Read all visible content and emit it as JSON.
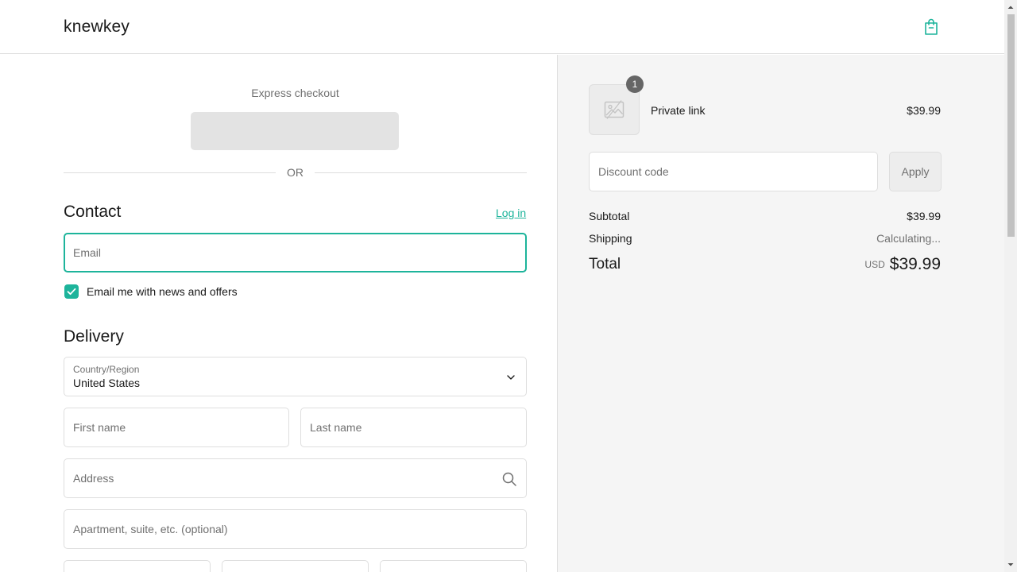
{
  "header": {
    "brand": "knewkey",
    "cart_icon": "shopping-bag-icon"
  },
  "express": {
    "label": "Express checkout",
    "divider": "OR"
  },
  "contact": {
    "title": "Contact",
    "login_label": "Log in",
    "email_placeholder": "Email",
    "newsletter_label": "Email me with news and offers",
    "newsletter_checked": true
  },
  "delivery": {
    "title": "Delivery",
    "country_label": "Country/Region",
    "country_value": "United States",
    "first_name_placeholder": "First name",
    "last_name_placeholder": "Last name",
    "address_placeholder": "Address",
    "apartment_placeholder": "Apartment, suite, etc. (optional)"
  },
  "summary": {
    "item": {
      "name": "Private link",
      "price": "$39.99",
      "quantity": "1",
      "image_icon": "image-placeholder-icon"
    },
    "discount_placeholder": "Discount code",
    "apply_label": "Apply",
    "subtotal_label": "Subtotal",
    "subtotal_value": "$39.99",
    "shipping_label": "Shipping",
    "shipping_value": "Calculating...",
    "total_label": "Total",
    "currency": "USD",
    "total_value": "$39.99"
  },
  "colors": {
    "accent": "#1db49b",
    "panel": "#f5f5f5",
    "border": "#dedede"
  }
}
